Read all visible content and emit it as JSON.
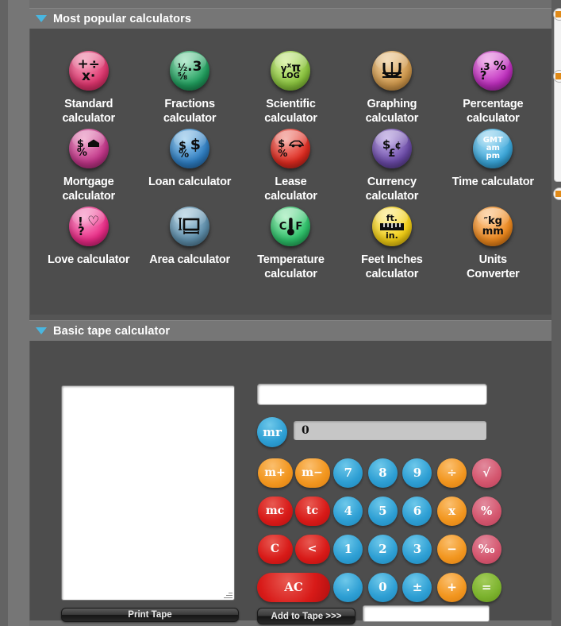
{
  "panels": {
    "popular": {
      "title": "Most popular calculators",
      "collapse_icon": "triangle-down-icon"
    },
    "tape": {
      "title": "Basic tape calculator",
      "collapse_icon": "triangle-down-icon"
    }
  },
  "calculators": [
    {
      "label": "Standard\ncalculator",
      "name": "standard",
      "color": "c-pink",
      "glyph": "+÷\nx·",
      "glyph_kind": "ops"
    },
    {
      "label": "Fractions\ncalculator",
      "name": "fractions",
      "color": "c-green",
      "glyph": "½ .3\n⅝",
      "glyph_kind": "fractions"
    },
    {
      "label": "Scientific\ncalculator",
      "name": "scientific",
      "color": "c-lgreen",
      "glyph": "yˣ π\nLOG",
      "glyph_kind": "sci"
    },
    {
      "label": "Graphing\ncalculator",
      "name": "graphing",
      "color": "c-tan",
      "glyph": "graph-curve",
      "glyph_kind": "graph"
    },
    {
      "label": "Percentage\ncalculator",
      "name": "percentage",
      "color": "c-magenta",
      "glyph": ".3 %\n?",
      "glyph_kind": "pct"
    },
    {
      "label": "Mortgage\ncalculator",
      "name": "mortgage",
      "color": "c-rose",
      "glyph": "$ ⌂\n%",
      "glyph_kind": "mortgage"
    },
    {
      "label": "Loan calculator",
      "name": "loan",
      "color": "c-blue",
      "glyph": "$ $\n%",
      "glyph_kind": "loan"
    },
    {
      "label": "Lease\ncalculator",
      "name": "lease",
      "color": "c-red",
      "glyph": "$ car\n%",
      "glyph_kind": "lease"
    },
    {
      "label": "Currency\ncalculator",
      "name": "currency",
      "color": "c-purple",
      "glyph": "$ ¢\n£",
      "glyph_kind": "currency"
    },
    {
      "label": "Time calculator",
      "name": "time",
      "color": "c-cyan",
      "glyph": "GMT\nam\npm",
      "glyph_kind": "time"
    },
    {
      "label": "Love calculator",
      "name": "love",
      "color": "c-hotpink",
      "glyph": "! ♥\n?",
      "glyph_kind": "love"
    },
    {
      "label": "Area calculator",
      "name": "area",
      "color": "c-steel",
      "glyph": "area-rect",
      "glyph_kind": "area"
    },
    {
      "label": "Temperature\ncalculator",
      "name": "temperature",
      "color": "c-emerald",
      "glyph": "C F",
      "glyph_kind": "temp"
    },
    {
      "label": "Feet Inches\ncalculator",
      "name": "feet-inches",
      "color": "c-yellow",
      "glyph": "ft.\nin.",
      "glyph_kind": "feet"
    },
    {
      "label": "Units\nConverter",
      "name": "units",
      "color": "c-orange",
      "glyph": "″ kg\nmm",
      "glyph_kind": "units"
    }
  ],
  "tape": {
    "tape_text": "",
    "tape_placeholder": "",
    "expression_value": "",
    "expression_placeholder": "",
    "memory_recall_label": "mr",
    "memory_display_value": "0",
    "print_tape_label": "Print Tape",
    "add_to_tape_label": "Add to Tape >>>",
    "add_to_tape_value": "",
    "add_to_tape_placeholder": "",
    "keys": [
      {
        "label": "m+",
        "name": "memory-add",
        "color": "k-orange",
        "wide": false,
        "mem": true
      },
      {
        "label": "m−",
        "name": "memory-subtract",
        "color": "k-orange",
        "wide": false,
        "mem": true
      },
      {
        "label": "7",
        "name": "digit-7",
        "color": "k-blue",
        "wide": false,
        "mem": false
      },
      {
        "label": "8",
        "name": "digit-8",
        "color": "k-blue",
        "wide": false,
        "mem": false
      },
      {
        "label": "9",
        "name": "digit-9",
        "color": "k-blue",
        "wide": false,
        "mem": false
      },
      {
        "label": "÷",
        "name": "divide",
        "color": "k-orange",
        "wide": false,
        "mem": false
      },
      {
        "label": "√",
        "name": "square-root",
        "color": "k-pink",
        "wide": false,
        "mem": false
      },
      {
        "label": "mc",
        "name": "memory-clear",
        "color": "k-red",
        "wide": false,
        "mem": true
      },
      {
        "label": "tc",
        "name": "tape-clear",
        "color": "k-red",
        "wide": false,
        "mem": true
      },
      {
        "label": "4",
        "name": "digit-4",
        "color": "k-blue",
        "wide": false,
        "mem": false
      },
      {
        "label": "5",
        "name": "digit-5",
        "color": "k-blue",
        "wide": false,
        "mem": false
      },
      {
        "label": "6",
        "name": "digit-6",
        "color": "k-blue",
        "wide": false,
        "mem": false
      },
      {
        "label": "x",
        "name": "multiply",
        "color": "k-orange",
        "wide": false,
        "mem": false
      },
      {
        "label": "%",
        "name": "percent",
        "color": "k-pink",
        "wide": false,
        "mem": false
      },
      {
        "label": "C",
        "name": "clear-entry",
        "color": "k-red",
        "wide": false,
        "mem": true
      },
      {
        "label": "<",
        "name": "backspace",
        "color": "k-red",
        "wide": false,
        "mem": true
      },
      {
        "label": "1",
        "name": "digit-1",
        "color": "k-blue",
        "wide": false,
        "mem": false
      },
      {
        "label": "2",
        "name": "digit-2",
        "color": "k-blue",
        "wide": false,
        "mem": false
      },
      {
        "label": "3",
        "name": "digit-3",
        "color": "k-blue",
        "wide": false,
        "mem": false
      },
      {
        "label": "−",
        "name": "subtract",
        "color": "k-orange",
        "wide": false,
        "mem": false
      },
      {
        "label": "‰",
        "name": "per-mille",
        "color": "k-pink",
        "wide": false,
        "mem": false
      },
      {
        "label": "AC",
        "name": "all-clear",
        "color": "k-red",
        "wide": true,
        "mem": false
      },
      {
        "label": ".",
        "name": "decimal-point",
        "color": "k-blue",
        "wide": false,
        "mem": false
      },
      {
        "label": "0",
        "name": "digit-0",
        "color": "k-blue",
        "wide": false,
        "mem": false
      },
      {
        "label": "±",
        "name": "sign-toggle",
        "color": "k-blue",
        "wide": false,
        "mem": false
      },
      {
        "label": "+",
        "name": "add",
        "color": "k-orange",
        "wide": false,
        "mem": false
      },
      {
        "label": "=",
        "name": "equals",
        "color": "k-green",
        "wide": false,
        "mem": false
      }
    ]
  },
  "colors": {
    "accent": "#49b6e0",
    "panel_header": "#767676",
    "panel_body": "#4d4d4d",
    "page_background": "#6e6e6e"
  }
}
